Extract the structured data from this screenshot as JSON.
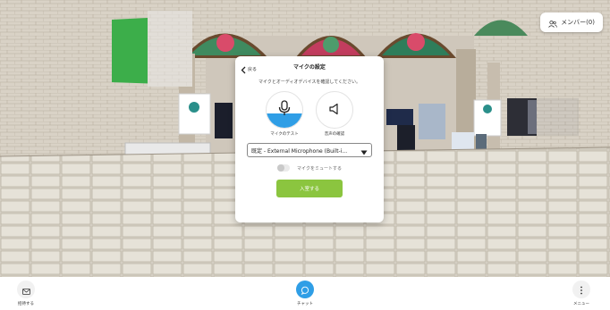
{
  "header": {
    "members_label": "メンバー(0)"
  },
  "dialog": {
    "back_label": "戻る",
    "title": "マイクの設定",
    "description": "マイクとオーディオデバイスを確認してください。",
    "mic_test_label": "マイクのテスト",
    "speaker_test_label": "音声の確認",
    "mic_level": 0.4,
    "device_selected": "既定 - External Microphone (Built-i...",
    "mute_label": "マイクをミュートする",
    "mute_enabled": false,
    "join_label": "入室する"
  },
  "bottom_bar": {
    "left_label": "招待する",
    "center_label": "チャット",
    "right_label": "メニュー"
  },
  "colors": {
    "accent_blue": "#2f9ee6",
    "join_green": "#8bc53f"
  },
  "icons": {
    "members": "people-icon",
    "back": "chevron-left-icon",
    "mic": "microphone-icon",
    "speaker": "speaker-icon",
    "dropdown": "caret-down-icon",
    "invite": "mail-icon",
    "chat": "chat-bubble-icon",
    "menu": "more-vertical-icon"
  }
}
